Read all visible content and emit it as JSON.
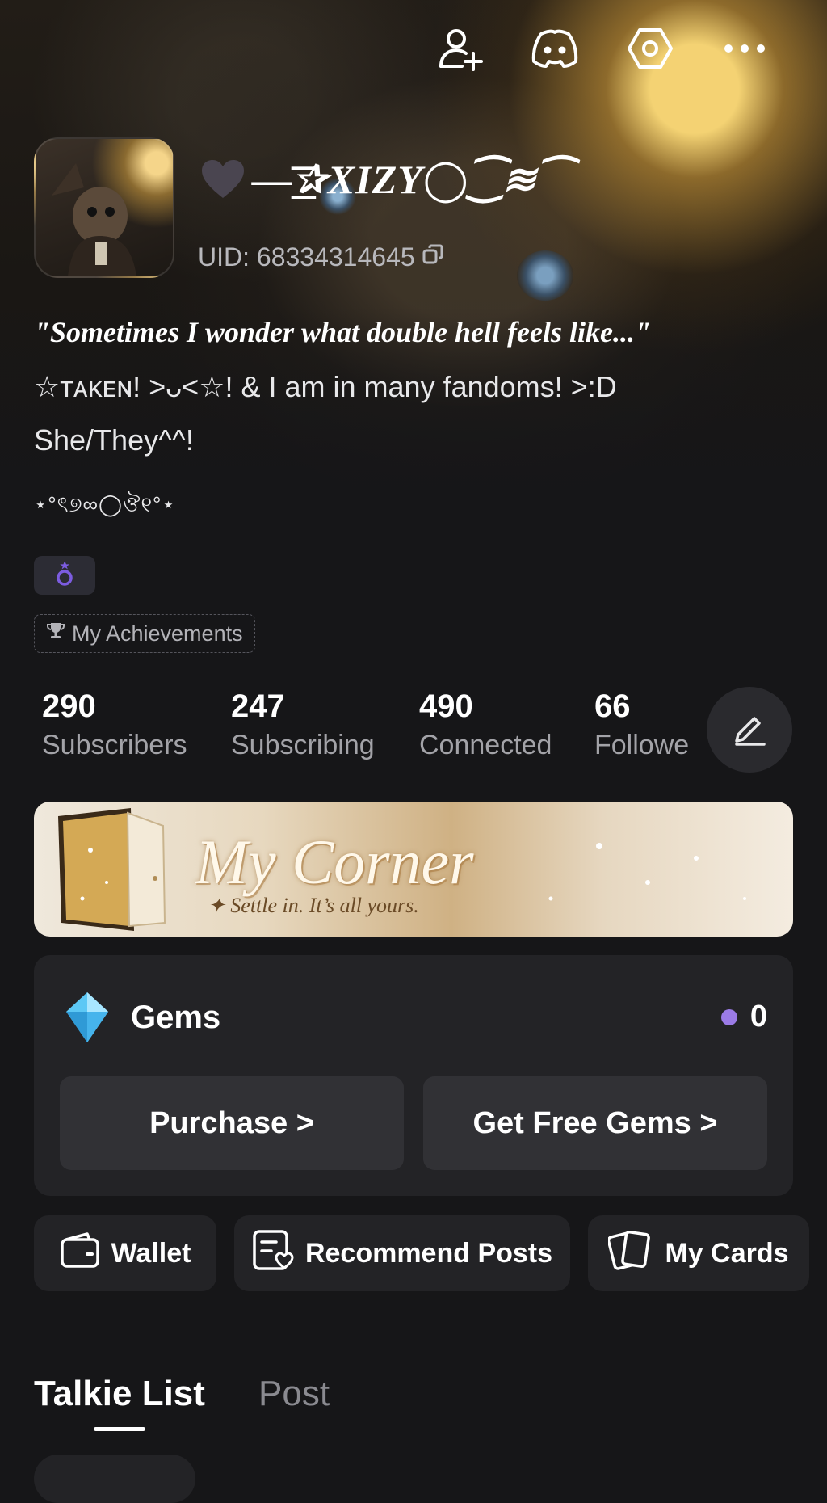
{
  "top_icons": [
    "add-friend-icon",
    "discord-icon",
    "hexagon-settings-icon",
    "more-icon"
  ],
  "profile": {
    "username": "—͟͞✰XIZY◯⁐≋⁀",
    "uid": "UID: 68334314645",
    "bio_line1": "\"Sometimes I wonder what double hell feels like...\"",
    "bio_line2": " ☆ᴛᴀᴋᴇɴ! >ᴗ<☆! & I am in many fandoms! >:D",
    "bio_line3": "She/They^^!",
    "bio_line4": "⋆°ৎ୭∞◯ঔ୧°⋆"
  },
  "achievements_label": "My Achievements",
  "stats": [
    {
      "value": "290",
      "label": "Subscribers"
    },
    {
      "value": "247",
      "label": "Subscribing"
    },
    {
      "value": "490",
      "label": "Connected"
    },
    {
      "value": "66",
      "label": "Followe"
    }
  ],
  "banner": {
    "title": "My Corner",
    "subtitle": "✦ Settle in. It’s all yours."
  },
  "gems": {
    "title": "Gems",
    "count": "0",
    "purchase": "Purchase >",
    "free": "Get Free Gems >"
  },
  "shortcuts": [
    {
      "label": "Wallet",
      "icon": "wallet-icon"
    },
    {
      "label": "Recommend Posts",
      "icon": "recommend-posts-icon"
    },
    {
      "label": "My Cards",
      "icon": "cards-icon"
    }
  ],
  "tabs": {
    "active": "Talkie List",
    "other": "Post"
  },
  "colors": {
    "background": "#161618",
    "card": "#232326",
    "accent": "#9b7be6",
    "badge": "#7c5ce0"
  }
}
